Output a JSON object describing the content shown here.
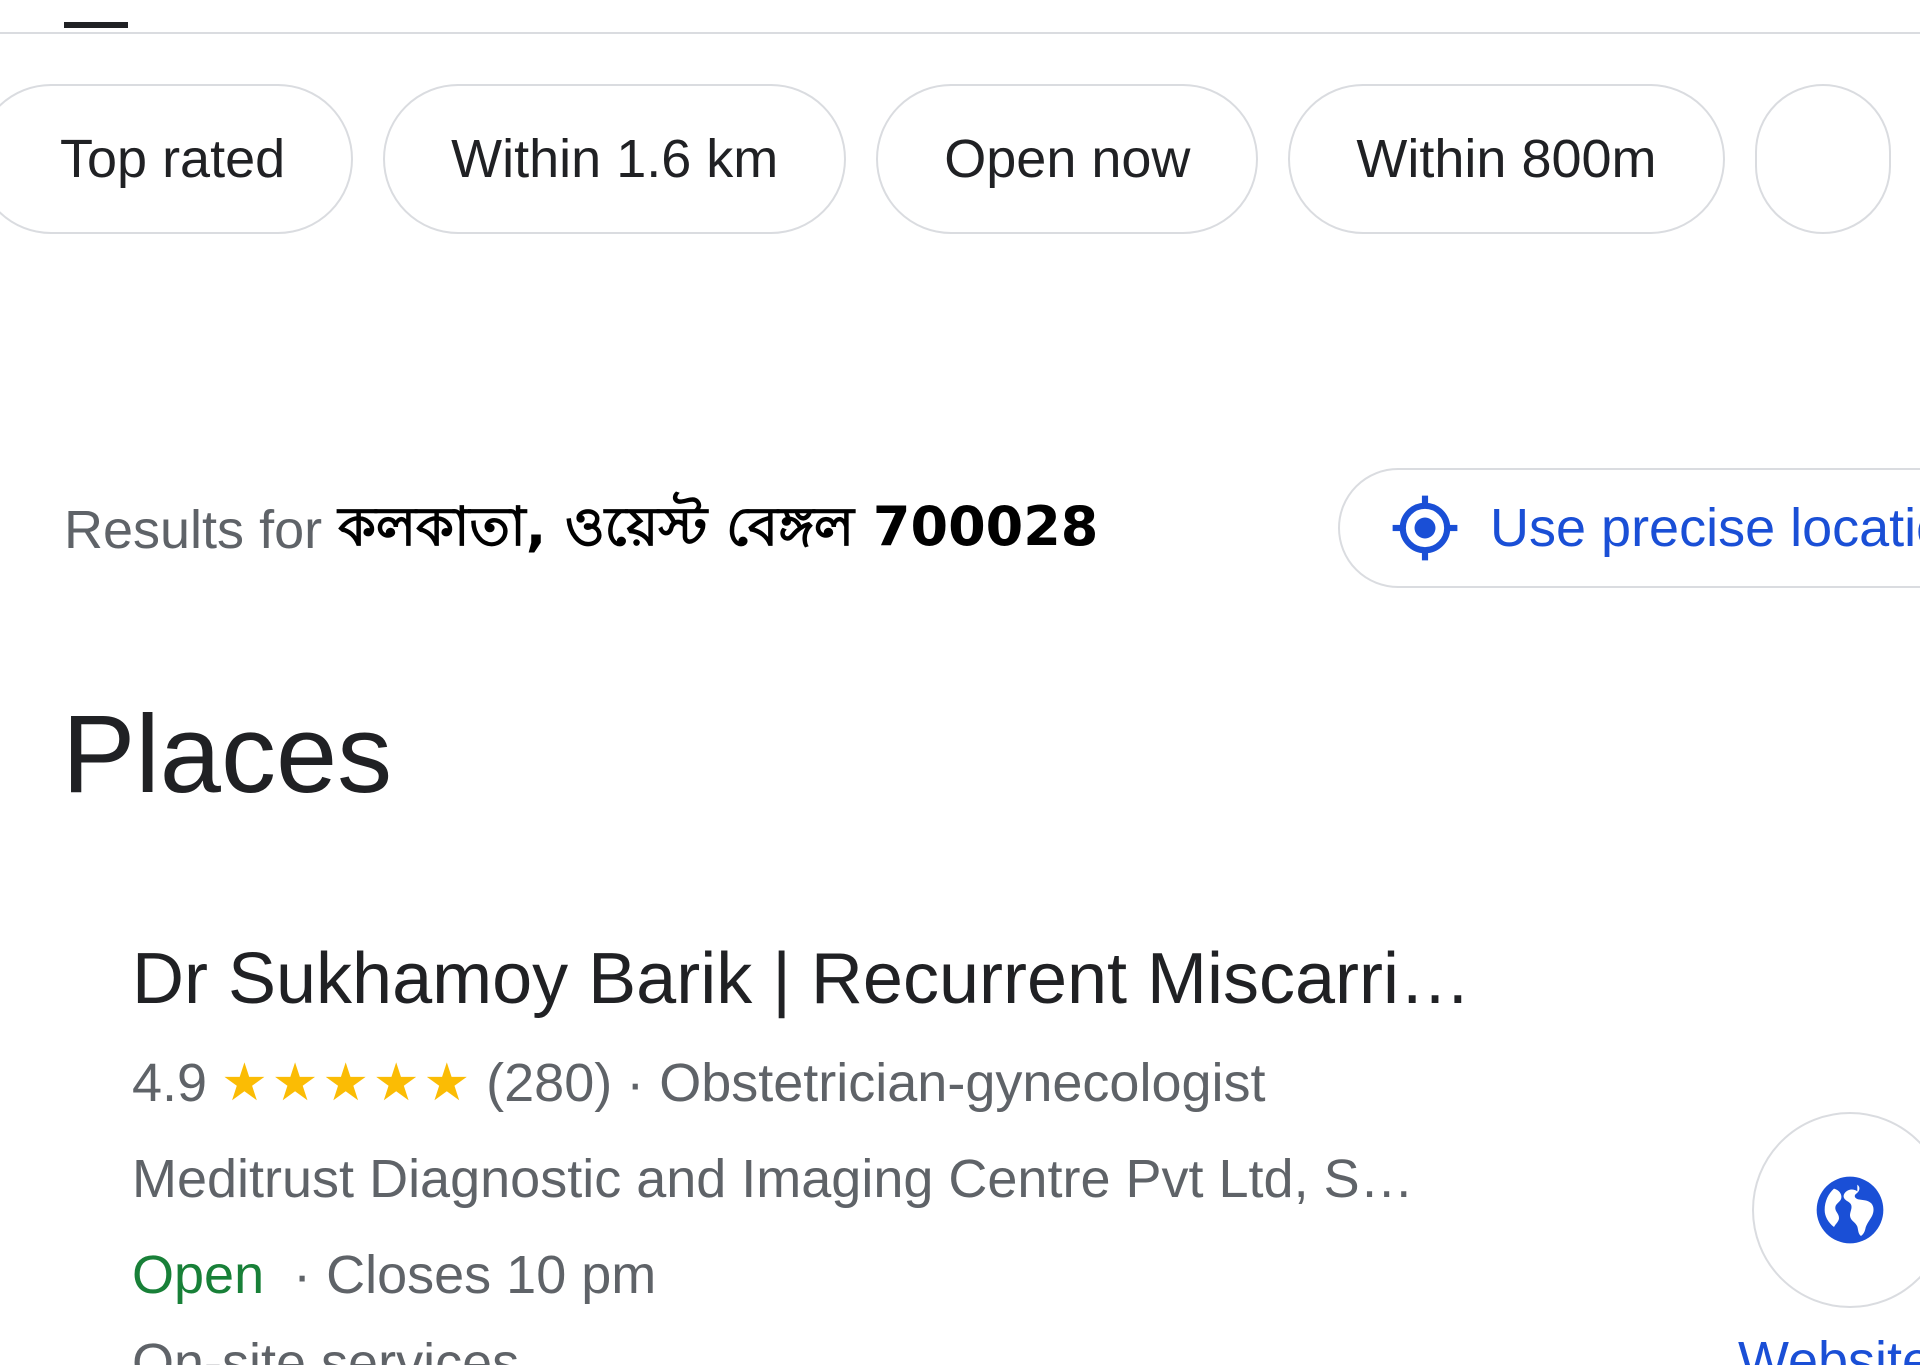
{
  "filters": {
    "chips": [
      "Top rated",
      "Within 1.6 km",
      "Open now",
      "Within 800m"
    ]
  },
  "location": {
    "results_prefix": "Results for",
    "place": "কলকাতা, ওয়েস্ট বেঙ্গল 700028",
    "precise_button_label": "Use precise location",
    "precise_icon": "my-location-icon"
  },
  "places": {
    "heading": "Places",
    "results": [
      {
        "name": "Dr Sukhamoy Barik | Recurrent Miscarri…",
        "rating": "4.9",
        "stars": "★★★★★",
        "star_count": 5,
        "review_count": "(280)",
        "category": "· Obstetrician-gynecologist",
        "address": "Meditrust Diagnostic and Imaging Centre Pvt Ltd, S…",
        "open_status": "Open",
        "hours": "· Closes 10 pm",
        "services": "On-site services",
        "website_label": "Website",
        "website_icon": "globe-icon"
      }
    ]
  },
  "colors": {
    "accent_blue": "#1a4fd6",
    "open_green": "#188038",
    "star_yellow": "#fbbc04",
    "secondary_text": "#5f6368",
    "border": "#dadce0"
  }
}
